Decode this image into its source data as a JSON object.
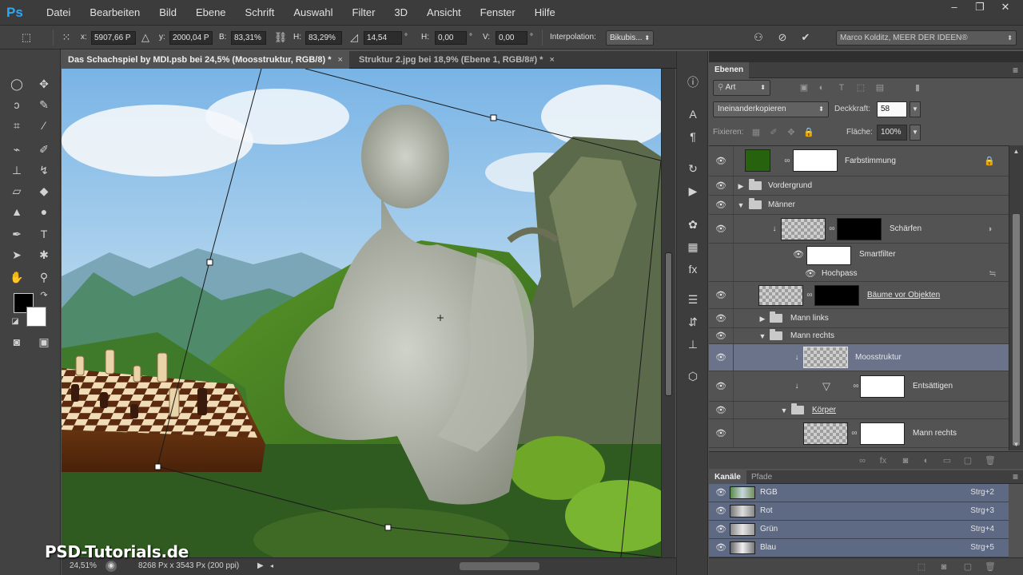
{
  "menubar": {
    "logo": "Ps",
    "items": [
      "Datei",
      "Bearbeiten",
      "Bild",
      "Ebene",
      "Schrift",
      "Auswahl",
      "Filter",
      "3D",
      "Ansicht",
      "Fenster",
      "Hilfe"
    ],
    "window_controls": [
      "minimize-icon",
      "restore-icon",
      "close-icon"
    ]
  },
  "options": {
    "x_label": "x:",
    "x_value": "5907,66 P",
    "y_label": "y:",
    "y_value": "2000,04 P",
    "b_label": "B:",
    "b_value": "83,31%",
    "h_label": "H:",
    "h_value": "83,29%",
    "angle_value": "14,54",
    "deg": "°",
    "hskew_label": "H:",
    "hskew_value": "0,00",
    "vskew_label": "V:",
    "vskew_value": "0,00",
    "interpolation_label": "Interpolation:",
    "interpolation_value": "Bikubis...",
    "workspace": "Marco Kolditz, MEER DER IDEEN®"
  },
  "document_tabs": [
    {
      "label": "Das Schachspiel by MDI.psb bei 24,5% (Moosstruktur, RGB/8) *",
      "close": "×",
      "active": true
    },
    {
      "label": "Struktur 2.jpg bei 18,9% (Ebene 1, RGB/8#) *",
      "close": "×",
      "active": false
    }
  ],
  "status": {
    "zoom": "24,51%",
    "doc_size": "8268 Px x 3543 Px (200 ppi)"
  },
  "watermark": "PSD-Tutorials.de",
  "layers_panel": {
    "tab": "Ebenen",
    "menu": "≡",
    "filter_kind": "Art",
    "blend_mode": "Ineinanderkopieren",
    "opacity_label": "Deckkraft:",
    "opacity_value": "58",
    "lock_label": "Fixieren:",
    "fill_label": "Fläche:",
    "fill_value": "100%",
    "layers": [
      {
        "name": "Farbstimmung",
        "type": "adjustment"
      },
      {
        "name": "Vordergrund",
        "type": "group"
      },
      {
        "name": "Männer",
        "type": "group"
      },
      {
        "name": "Schärfen",
        "type": "smart"
      },
      {
        "name": "Smartfilter",
        "type": "filter"
      },
      {
        "name": "Hochpass",
        "type": "filter-item"
      },
      {
        "name": "Bäume vor Objekten",
        "type": "smart"
      },
      {
        "name": "Mann links",
        "type": "group"
      },
      {
        "name": "Mann rechts",
        "type": "group"
      },
      {
        "name": "Moosstruktur",
        "type": "pixel",
        "selected": true
      },
      {
        "name": "Entsättigen",
        "type": "adjustment"
      },
      {
        "name": "Körper",
        "type": "group"
      },
      {
        "name": "Mann rechts",
        "type": "pixel"
      }
    ]
  },
  "channels_panel": {
    "tabs": [
      "Kanäle",
      "Pfade"
    ],
    "channels": [
      {
        "name": "RGB",
        "shortcut": "Strg+2"
      },
      {
        "name": "Rot",
        "shortcut": "Strg+3"
      },
      {
        "name": "Grün",
        "shortcut": "Strg+4"
      },
      {
        "name": "Blau",
        "shortcut": "Strg+5"
      }
    ]
  }
}
